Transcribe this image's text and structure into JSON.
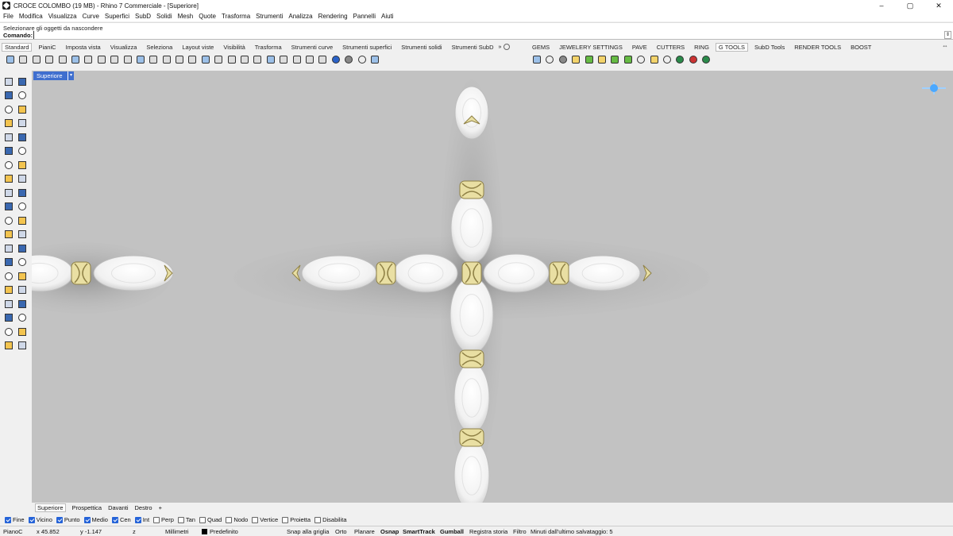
{
  "window": {
    "title": "CROCE COLOMBO (19 MB) - Rhino 7 Commerciale - [Superiore]",
    "controls": [
      "–",
      "▢",
      "✕"
    ]
  },
  "menu": [
    "File",
    "Modifica",
    "Visualizza",
    "Curve",
    "Superfici",
    "SubD",
    "Solidi",
    "Mesh",
    "Quote",
    "Trasforma",
    "Strumenti",
    "Analizza",
    "Rendering",
    "Pannelli",
    "Aiuti"
  ],
  "command": {
    "history": "Selezionare gli oggetti da nascondere",
    "prompt": "Comando:",
    "value": "",
    "scroll_glyph": "⇕"
  },
  "toolbar_tabs_left": [
    "Standard",
    "PianiC",
    "Imposta vista",
    "Visualizza",
    "Seleziona",
    "Layout viste",
    "Visibilità",
    "Trasforma",
    "Strumenti curve",
    "Strumenti superfici",
    "Strumenti solidi",
    "Strumenti SubD"
  ],
  "toolbar_tabs_more": "»",
  "toolbar_tabs_right": [
    "GEMS",
    "JEWELERY SETTINGS",
    "PAVE",
    "CUTTERS",
    "RING",
    "G TOOLS",
    "SubD Tools",
    "RENDER TOOLS",
    "BOOST"
  ],
  "toolbar_tabs_active_right": "G TOOLS",
  "toolbar_tabs_scroll": "⇔",
  "toolbar_icons_left": [
    "new-file",
    "open-file",
    "save",
    "print",
    "import",
    "cut",
    "copy",
    "paste",
    "undo",
    "pan",
    "rotate-view",
    "zoom-dynamic",
    "zoom-window",
    "zoom-extents",
    "zoom-selected",
    "zoom-all",
    "four-viewports",
    "set-view",
    "capture",
    "grid-settings",
    "object-properties",
    "lights",
    "wireframe",
    "shaded",
    "rendered",
    "ghosted",
    "xray",
    "options",
    "help"
  ],
  "toolbar_icons_right": [
    "gem-table",
    "oval-gem",
    "prong-setting",
    "pave-cutter",
    "ring-shank",
    "gem-studio",
    "bezel",
    "cutter-array",
    "pipe-setting",
    "text-engrave",
    "chain",
    "render-green",
    "rhino-red",
    "rhino-green"
  ],
  "viewport": {
    "label": "Superiore",
    "dropdown_glyph": "▾",
    "background": "#c2c2c2"
  },
  "scene": {
    "object": "cross-pendant",
    "gem_color": "#f4f4f4",
    "metal_color": "#e9dfa3"
  },
  "viewport_tabs": [
    "Superiore",
    "Prospettica",
    "Davanti",
    "Destro"
  ],
  "viewport_tabs_add": "+",
  "osnaps": [
    {
      "label": "Fine",
      "on": true
    },
    {
      "label": "Vicino",
      "on": true
    },
    {
      "label": "Punto",
      "on": true
    },
    {
      "label": "Medio",
      "on": true
    },
    {
      "label": "Cen",
      "on": true
    },
    {
      "label": "Int",
      "on": true
    },
    {
      "label": "Perp",
      "on": false
    },
    {
      "label": "Tan",
      "on": false
    },
    {
      "label": "Quad",
      "on": false
    },
    {
      "label": "Nodo",
      "on": false
    },
    {
      "label": "Vertice",
      "on": false
    },
    {
      "label": "Proietta",
      "on": false
    },
    {
      "label": "Disabilita",
      "on": false
    }
  ],
  "status": {
    "cplane": "PianoC",
    "x": "x 45.852",
    "y": "y -1.147",
    "z": "z",
    "units": "Millimetri",
    "layer": "Predefinito",
    "snap_grid": "Snap alla griglia",
    "ortho": "Orto",
    "planar": "Planare",
    "osnap": "Osnap",
    "smarttrack": "SmartTrack",
    "gumball": "Gumball",
    "history": "Registra storia",
    "filter": "Filtro",
    "autosave": "Minuti dall'ultimo salvataggio: 5"
  }
}
